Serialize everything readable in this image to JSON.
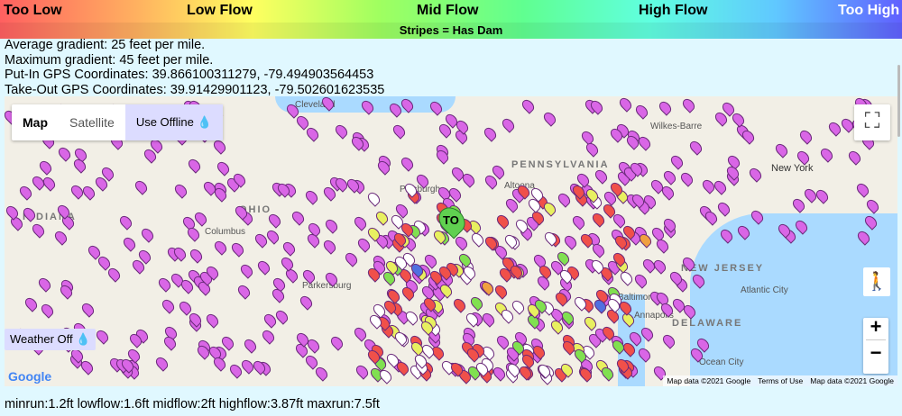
{
  "legend": {
    "too_low": "Too Low",
    "low_flow": "Low Flow",
    "mid_flow": "Mid Flow",
    "high_flow": "High Flow",
    "too_high": "Too High",
    "stripes": "Stripes = Has Dam"
  },
  "info": {
    "avg": "Average gradient: 25 feet per mile.",
    "max": "Maximum gradient: 45 feet per mile.",
    "putin": "Put-In GPS Coordinates: 39.866100311279, -79.494903564453",
    "takeout": "Take-Out GPS Coordinates: 39.91429901123, -79.502601623535"
  },
  "map": {
    "map_button": "Map",
    "satellite_button": "Satellite",
    "offline_button": "Use Offline 💧",
    "weather_button": "Weather Off 💧",
    "labels": {
      "cleveland": "Cleveland",
      "pittsburgh": "Pittsburgh",
      "columbus": "Columbus",
      "altoona": "Altoona",
      "wilkes": "Wilkes-Barre",
      "newyork": "New York",
      "baltimore": "Baltimore",
      "atlantic": "Atlantic City",
      "annapolis": "Annapolis",
      "ocean": "Ocean City",
      "parkersburg": "Parkersburg"
    },
    "states": {
      "pa": "PENNSYLVANIA",
      "nj": "NEW JERSEY",
      "de": "DELAWARE",
      "in": "INDIANA",
      "oh": "OHIO"
    },
    "marker_label": "TO",
    "attribution1": "Map data ©2021 Google",
    "terms": "Terms of Use",
    "attribution2": "Map data ©2021 Google",
    "google": "Google",
    "colors": {
      "purple": "#d966e6",
      "red": "#f0504a",
      "white": "#ffffff",
      "green": "#80e050",
      "yellow": "#e8f060",
      "orange": "#f0a040",
      "blue": "#5070e0"
    }
  },
  "footer": "minrun:1.2ft lowflow:1.6ft midflow:2ft highflow:3.87ft maxrun:7.5ft"
}
